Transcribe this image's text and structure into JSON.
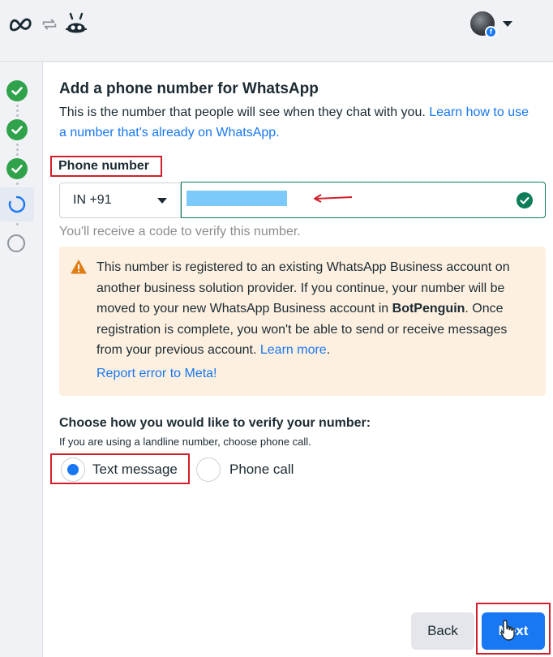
{
  "header": {
    "logo": "meta-logo",
    "sync_icon": "sync-arrows-icon",
    "bot_icon": "botpenguin-icon",
    "account_badge": "f"
  },
  "stepper": {
    "steps": [
      {
        "status": "complete"
      },
      {
        "status": "complete"
      },
      {
        "status": "complete"
      },
      {
        "status": "in-progress"
      },
      {
        "status": "pending"
      }
    ]
  },
  "form": {
    "title": "Add a phone number for WhatsApp",
    "subtitle_text": "This is the number that people will see when they chat with you. ",
    "subtitle_link": "Learn how to use a number that's already on WhatsApp.",
    "phone_label": "Phone number",
    "country_code": "IN +91",
    "helper": "You'll receive a code to verify this number.",
    "warning": {
      "text_before": "This number is registered to an existing WhatsApp Business account on another business solution provider. If you continue, your number will be moved to your new WhatsApp Business account in ",
      "bold": "BotPenguin",
      "text_after": ". Once registration is complete, you won't be able to send or receive messages from your previous account. ",
      "link": "Learn more",
      "period": ".",
      "report_link": "Report error to Meta!"
    },
    "verify_title": "Choose how you would like to verify your number:",
    "verify_help": "If you are using a landline number, choose phone call.",
    "options": [
      {
        "label": "Text message",
        "selected": true
      },
      {
        "label": "Phone call",
        "selected": false
      }
    ]
  },
  "footer": {
    "back_label": "Back",
    "next_label": "Next"
  },
  "colors": {
    "accent": "#1877f2",
    "success": "#31a24c",
    "annotation": "#d21f2b",
    "warning_bg": "#fdf0e0"
  }
}
